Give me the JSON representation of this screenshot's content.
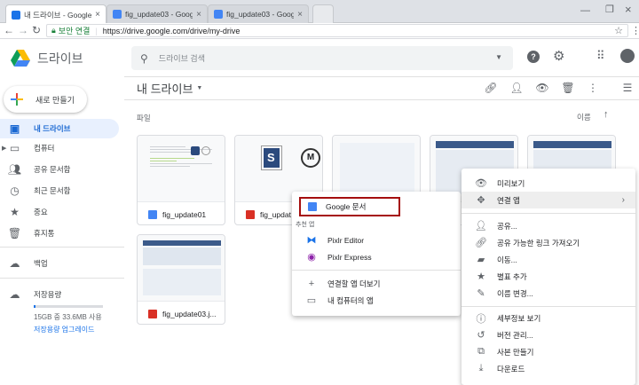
{
  "browser": {
    "tabs": [
      {
        "label": "내 드라이브 - Google 드",
        "active": true,
        "favicon_color": "#1a73e8"
      },
      {
        "label": "fig_update03 - Google 문",
        "active": false,
        "favicon_color": "#4285f4"
      },
      {
        "label": "fig_update03 - Google 문",
        "active": false,
        "favicon_color": "#4285f4"
      }
    ],
    "security_label": "보안 연결",
    "url": "https://drive.google.com/drive/my-drive"
  },
  "header": {
    "product_name": "드라이브",
    "search_placeholder": "드라이브 검색"
  },
  "sidebar": {
    "new_button": "새로 만들기",
    "items": [
      {
        "label": "내 드라이브",
        "icon": "drive-icon"
      },
      {
        "label": "컴퓨터",
        "icon": "computer-icon"
      },
      {
        "label": "공유 문서함",
        "icon": "shared-icon"
      },
      {
        "label": "최근 문서함",
        "icon": "clock-icon"
      },
      {
        "label": "중요",
        "icon": "star-icon"
      },
      {
        "label": "휴지통",
        "icon": "trash-icon"
      },
      {
        "label": "백업",
        "icon": "cloud-icon"
      },
      {
        "label": "저장용량",
        "icon": "storage-cloud-icon"
      }
    ],
    "storage_used": "15GB 중 33.6MB 사용",
    "storage_upgrade": "저장용량 업그레이드"
  },
  "main": {
    "breadcrumb": "내 드라이브",
    "section_label": "파일",
    "sort_label": "이름",
    "files": [
      {
        "name": "fig_update01",
        "type": "doc"
      },
      {
        "name": "fig_updat",
        "type": "image"
      },
      {
        "name": "",
        "type": "doc"
      },
      {
        "name": "",
        "type": "doc"
      },
      {
        "name": "",
        "type": "doc"
      },
      {
        "name": "fig_update03.j...",
        "type": "image"
      }
    ]
  },
  "open_with_menu": {
    "google_docs": "Google 문서",
    "suggested_header": "추천 앱",
    "apps": [
      "Pixlr Editor",
      "Pixlr Express"
    ],
    "more_apps": "연결할 앱 더보기",
    "computer_apps": "내 컴퓨터의 앱"
  },
  "context_menu": {
    "items": [
      {
        "label": "미리보기",
        "icon": "eye-icon"
      },
      {
        "label": "연결 앱",
        "icon": "move-icon"
      },
      {
        "label": "공유...",
        "icon": "add-person-icon"
      },
      {
        "label": "공유 가능한 링크 가져오기",
        "icon": "link-icon"
      },
      {
        "label": "이동...",
        "icon": "folder-move-icon"
      },
      {
        "label": "별표 추가",
        "icon": "star-icon"
      },
      {
        "label": "이름 변경...",
        "icon": "edit-icon"
      },
      {
        "label": "세부정보 보기",
        "icon": "info-icon"
      },
      {
        "label": "버전 관리...",
        "icon": "history-icon"
      },
      {
        "label": "사본 만들기",
        "icon": "copy-icon"
      },
      {
        "label": "다운로드",
        "icon": "download-icon"
      }
    ]
  },
  "colors": {
    "accent": "#1a73e8",
    "highlight_border": "#a50e0e"
  }
}
